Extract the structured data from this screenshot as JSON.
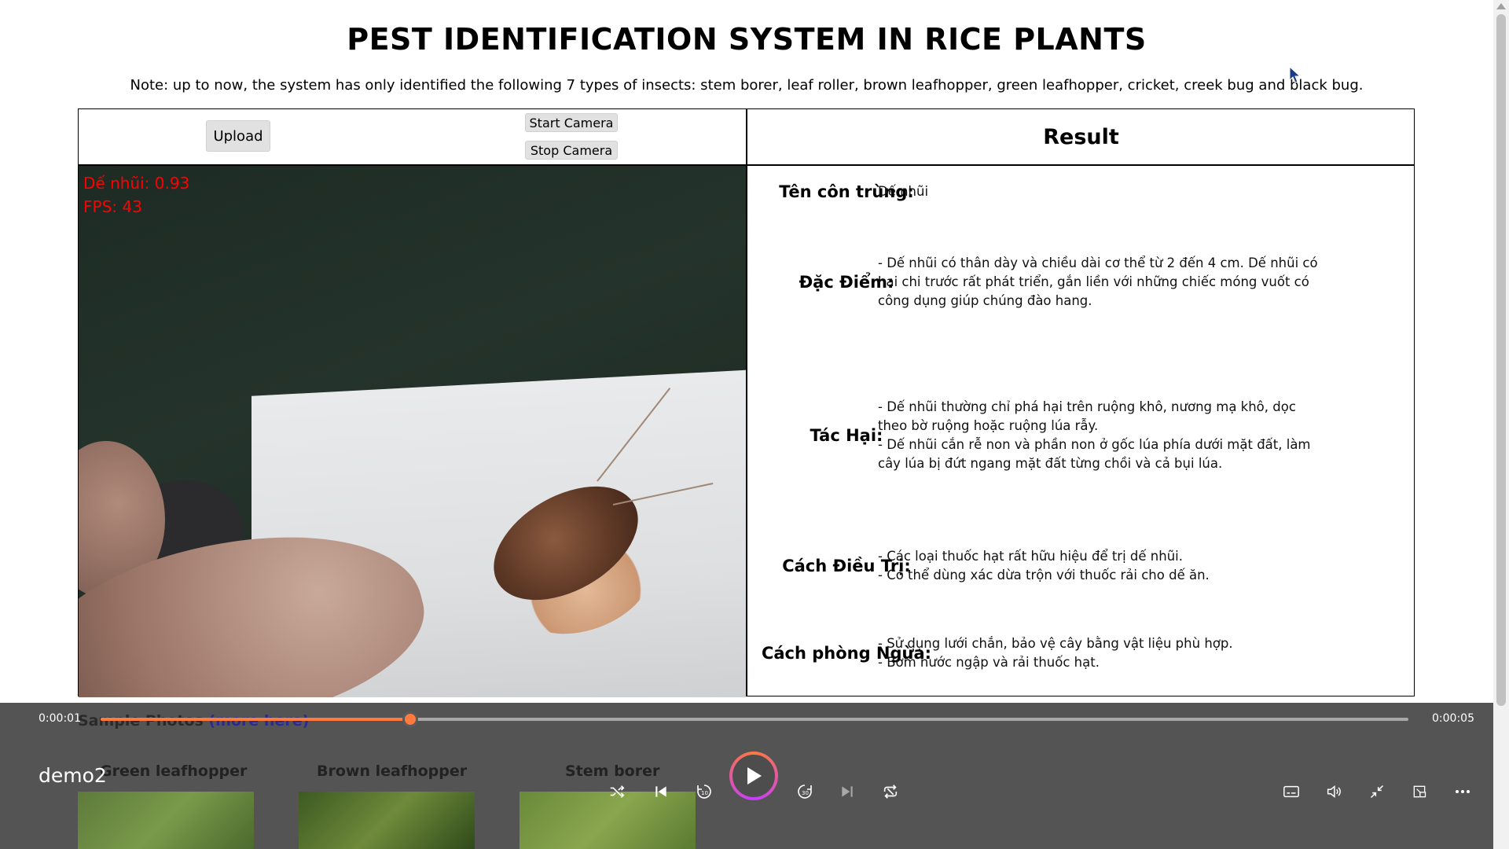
{
  "page": {
    "title": "PEST IDENTIFICATION SYSTEM IN RICE PLANTS",
    "note": "Note: up to now, the system has only identified the following 7 types of insects: stem borer, leaf roller, brown leafhopper, green leafhopper, cricket, creek bug and black bug."
  },
  "controls": {
    "upload": "Upload",
    "start_camera": "Start Camera",
    "stop_camera": "Stop Camera"
  },
  "camera": {
    "detection": "Dế nhũi: 0.93",
    "fps": "FPS: 43"
  },
  "result": {
    "header": "Result",
    "rows": [
      {
        "label": "Tên côn trùng:",
        "value": "Dế nhũi"
      },
      {
        "label": "Đặc Điểm:",
        "value": "- Dế nhũi có thân dày và chiều dài cơ thể từ 2 đến 4 cm. Dế nhũi có hai chi trước rất phát triển, gắn liền với những chiếc móng vuốt có công dụng giúp chúng đào hang."
      },
      {
        "label": "Tác Hại:",
        "value": "- Dế nhũi thường chỉ phá hại trên ruộng khô, nương mạ khô, dọc theo bờ ruộng hoặc ruộng lúa rẫy.\n- Dế nhũi cắn rễ non và phần non ở gốc lúa phía dưới mặt đất, làm cây lúa bị đứt ngang mặt đất từng chồi và cả bụi lúa."
      },
      {
        "label": "Cách Điều Trị:",
        "value": "- Các loại thuốc hạt rất hữu hiệu để trị dế nhũi.\n- Có thể dùng xác dừa trộn với thuốc rải cho dế ăn."
      },
      {
        "label": "Cách phòng Ngừa:",
        "value": "- Sử dụng lưới chắn, bảo vệ cây bằng vật liệu phù hợp.\n- Bơm nước ngập và rải thuốc hạt."
      }
    ]
  },
  "samples": {
    "label": "Sample Photos",
    "more": "(more here)",
    "items": [
      "Green leafhopper",
      "Brown leafhopper",
      "Stem borer"
    ]
  },
  "player": {
    "title": "demo2",
    "current_time": "0:00:01",
    "total_time": "0:00:05",
    "progress": 0.237,
    "accent_color": "#ff7a3c"
  }
}
